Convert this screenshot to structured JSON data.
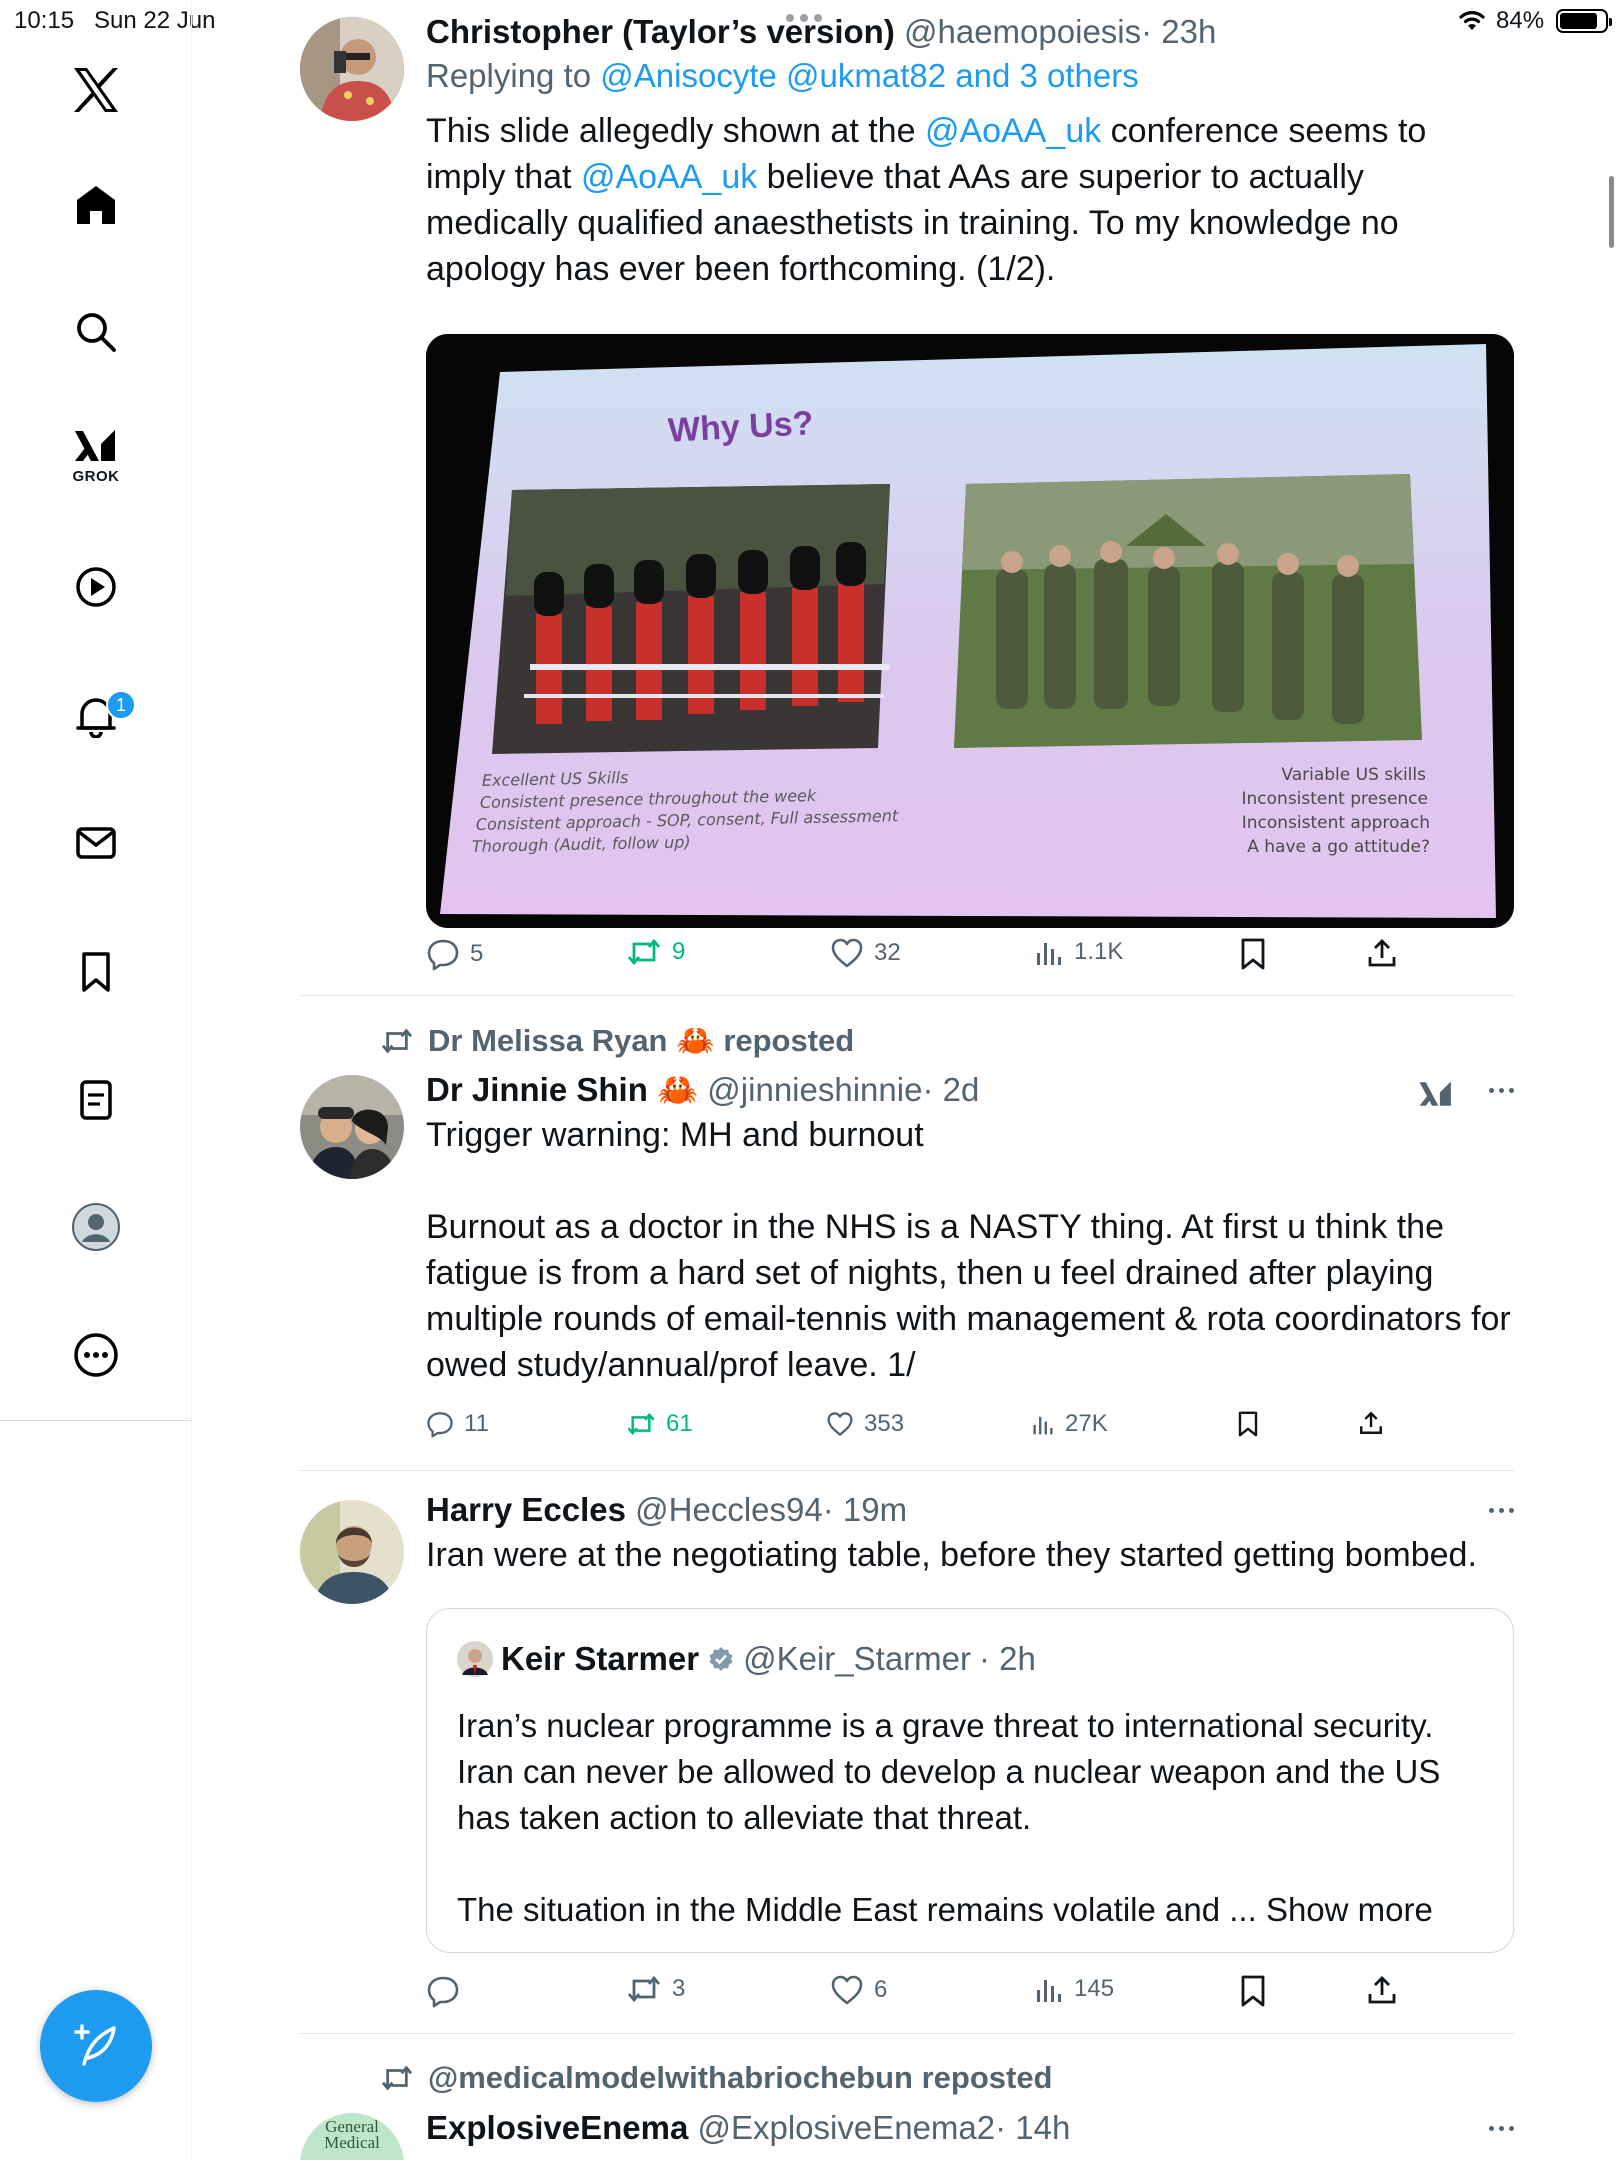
{
  "status": {
    "time": "10:15",
    "date": "Sun 22 Jun",
    "battery": "84%"
  },
  "sidebar": {
    "grok_label": "GROK",
    "notification_count": "1"
  },
  "tweets": [
    {
      "name": "Christopher (Taylor’s version)",
      "handle": "@haemopoiesis",
      "time": "· 23h",
      "replying_prefix": "Replying to",
      "replying_to": "@Anisocyte @ukmat82 and 3 others",
      "text_parts": [
        "This slide allegedly shown at the ",
        "@AoAA_uk",
        " conference seems to imply that ",
        "@AoAA_uk",
        " believe that AAs are superior to actually medically qualified anaesthetists in training. To my knowledge no apology has ever been forthcoming. (1/2)."
      ],
      "slide": {
        "title": "Why Us?",
        "left_lines": [
          "Excellent US Skills",
          "Consistent presence throughout the week",
          "Consistent approach - SOP, consent, Full assessment",
          "Thorough (Audit, follow up)"
        ],
        "right_lines": [
          "Variable US skills",
          "Inconsistent presence",
          "Inconsistent approach",
          "A have a go attitude?"
        ]
      },
      "stats": {
        "replies": "5",
        "reposts": "9",
        "likes": "32",
        "views": "1.1K"
      }
    },
    {
      "reposted_by": "Dr Melissa Ryan 🦀 reposted",
      "name": "Dr Jinnie Shin 🦀",
      "handle": "@jinnieshinnie",
      "time": "· 2d",
      "text1": "Trigger warning: MH and burnout",
      "text2": "Burnout as a doctor in the NHS is a NASTY thing. At first u think the fatigue is from a hard set of nights, then u feel drained after playing multiple rounds of email-tennis with management & rota coordinators for owed study/annual/prof leave. 1/",
      "stats": {
        "replies": "11",
        "reposts": "61",
        "likes": "353",
        "views": "27K"
      }
    },
    {
      "name": "Harry Eccles",
      "handle": "@Heccles94",
      "time": "· 19m",
      "text": "Iran were at the negotiating table, before they started getting bombed.",
      "quote": {
        "name": "Keir Starmer",
        "handle": "@Keir_Starmer",
        "time": "· 2h",
        "text1": "Iran’s nuclear programme is a grave threat to international security. Iran can never be allowed to develop a nuclear weapon and the US has taken action to alleviate that threat.",
        "text2": "The situation in the Middle East remains volatile and ...",
        "show_more": "Show more"
      },
      "stats": {
        "replies": "",
        "reposts": "3",
        "likes": "6",
        "views": "145"
      }
    },
    {
      "reposted_by": "@medicalmodelwithabriochebun reposted",
      "name": "ExplosiveEnema",
      "handle": "@ExplosiveEnema2",
      "time": "· 14h",
      "avatar_text": "General Medical"
    }
  ]
}
